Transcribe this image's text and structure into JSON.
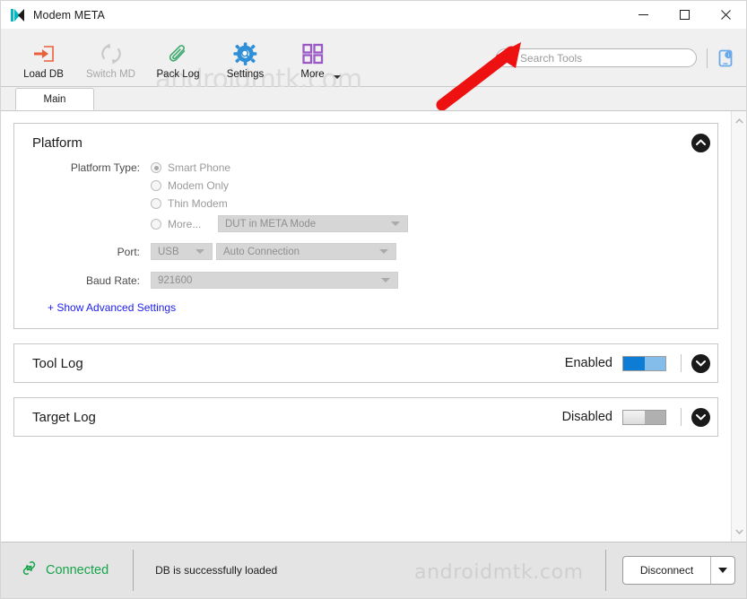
{
  "window": {
    "title": "Modem META",
    "icon": "app-logo-icon",
    "controls": {
      "minimize": "minimize-icon",
      "maximize": "maximize-icon",
      "close": "close-icon"
    }
  },
  "toolbar": {
    "watermark": "androidmtk.com",
    "items": [
      {
        "label": "Load DB",
        "icon": "load-db-icon",
        "disabled": false
      },
      {
        "label": "Switch MD",
        "icon": "switch-md-icon",
        "disabled": true
      },
      {
        "label": "Pack Log",
        "icon": "paperclip-icon",
        "disabled": false
      },
      {
        "label": "Settings",
        "icon": "gear-icon",
        "disabled": false
      },
      {
        "label": "More",
        "icon": "grid-icon",
        "disabled": false
      }
    ],
    "search": {
      "placeholder": "Search Tools",
      "value": "",
      "icon": "search-icon"
    },
    "device_button_icon": "device-info-icon"
  },
  "annotation": {
    "arrow_color": "#ee1111",
    "points_to": "search-input"
  },
  "tabs": [
    {
      "label": "Main",
      "active": true
    }
  ],
  "panels": {
    "platform": {
      "title": "Platform",
      "collapse_icon": "chevron-up-circle-icon",
      "platform_type_label": "Platform Type:",
      "options": [
        {
          "label": "Smart Phone",
          "checked": true
        },
        {
          "label": "Modem Only",
          "checked": false
        },
        {
          "label": "Thin Modem",
          "checked": false
        },
        {
          "label": "More...",
          "checked": false
        }
      ],
      "dut_mode": "DUT in META Mode",
      "port_label": "Port:",
      "port_type": "USB",
      "port_connection": "Auto Connection",
      "baud_label": "Baud Rate:",
      "baud_value": "921600",
      "advanced_link": "+ Show Advanced Settings"
    },
    "tool_log": {
      "title": "Tool Log",
      "status": "Enabled",
      "toggle_on": true,
      "expand_icon": "chevron-down-circle-icon"
    },
    "target_log": {
      "title": "Target Log",
      "status": "Disabled",
      "toggle_on": false,
      "expand_icon": "chevron-down-circle-icon"
    }
  },
  "scrollbar": {
    "up_icon": "chevron-up-icon",
    "down_icon": "chevron-down-icon"
  },
  "statusbar": {
    "connection_icon": "link-icon",
    "connection_text": "Connected",
    "message": "DB is successfully loaded",
    "watermark": "androidmtk.com",
    "disconnect_label": "Disconnect",
    "disconnect_dropdown_icon": "caret-down-icon"
  },
  "colors": {
    "accent_blue": "#0c7cd5",
    "connected_green": "#16a34a",
    "link_blue": "#2020f0",
    "annotation_red": "#ee1111"
  }
}
